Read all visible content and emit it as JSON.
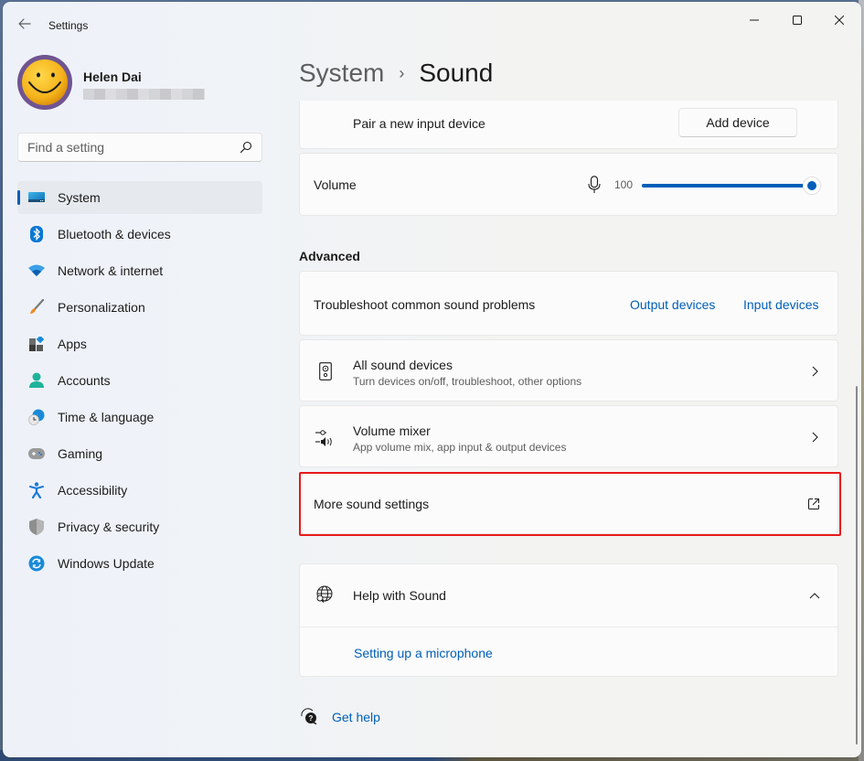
{
  "window": {
    "title": "Settings",
    "controls": {
      "minimize": "minimize",
      "maximize": "maximize",
      "close": "close"
    }
  },
  "profile": {
    "name": "Helen Dai",
    "email": ""
  },
  "search": {
    "placeholder": "Find a setting",
    "value": ""
  },
  "sidebar": {
    "items": [
      {
        "label": "System",
        "icon": "system-icon",
        "active": true
      },
      {
        "label": "Bluetooth & devices",
        "icon": "bluetooth-icon"
      },
      {
        "label": "Network & internet",
        "icon": "wifi-icon"
      },
      {
        "label": "Personalization",
        "icon": "paintbrush-icon"
      },
      {
        "label": "Apps",
        "icon": "apps-icon"
      },
      {
        "label": "Accounts",
        "icon": "person-icon"
      },
      {
        "label": "Time & language",
        "icon": "clock-globe-icon"
      },
      {
        "label": "Gaming",
        "icon": "gamepad-icon"
      },
      {
        "label": "Accessibility",
        "icon": "accessibility-icon"
      },
      {
        "label": "Privacy & security",
        "icon": "shield-icon"
      },
      {
        "label": "Windows Update",
        "icon": "update-icon"
      }
    ]
  },
  "breadcrumb": {
    "parent": "System",
    "separator": "›",
    "current": "Sound"
  },
  "input": {
    "pair_label": "Pair a new input device",
    "add_device_button": "Add device",
    "volume_label": "Volume",
    "volume_value": "100",
    "volume_fraction": 1.0
  },
  "advanced": {
    "title": "Advanced",
    "troubleshoot_label": "Troubleshoot common sound problems",
    "output_devices_link": "Output devices",
    "input_devices_link": "Input devices",
    "all_sound_devices": {
      "title": "All sound devices",
      "subtitle": "Turn devices on/off, troubleshoot, other options"
    },
    "volume_mixer": {
      "title": "Volume mixer",
      "subtitle": "App volume mix, app input & output devices"
    },
    "more_sound_settings": "More sound settings"
  },
  "help": {
    "title": "Help with Sound",
    "links": [
      "Setting up a microphone"
    ],
    "get_help": "Get help"
  },
  "colors": {
    "accent": "#005fb8",
    "highlight_box": "#e8191b"
  }
}
